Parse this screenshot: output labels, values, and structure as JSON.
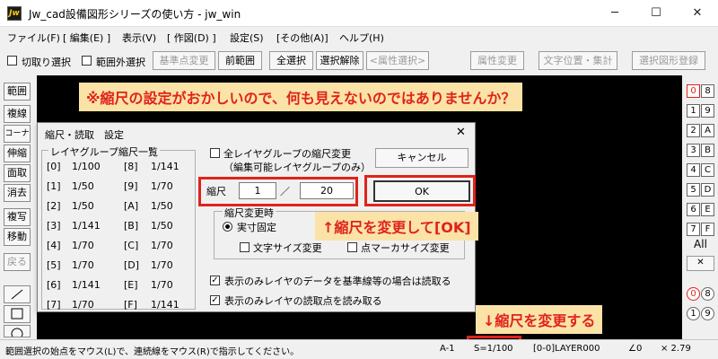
{
  "window": {
    "icon_text": "Jw",
    "title": "Jw_cad設備図形シリーズの使い方 - jw_win",
    "min": "─",
    "max": "☐",
    "close": "✕"
  },
  "menu": [
    "ファイル(F)",
    "[ 編集(E) ]",
    "表示(V)",
    "[ 作図(D) ]",
    "設定(S)",
    "[その他(A)]",
    "ヘルプ(H)"
  ],
  "toolbar": {
    "chk1": "切取り選択",
    "chk2": "範囲外選択",
    "base_point": "基準点変更",
    "prev_range": "前範囲",
    "select_all": "全選択",
    "deselect": "選択解除",
    "attr_select": "<属性選択>",
    "attr_change": "属性変更",
    "text_pos": "文字位置・集計",
    "register": "選択図形登録"
  },
  "left_tools": [
    "範囲",
    "複線",
    "コーナー",
    "伸縮",
    "面取",
    "消去",
    "複写",
    "移動",
    "戻る"
  ],
  "right_panel": {
    "row1": [
      [
        "0",
        "8"
      ],
      [
        "1",
        "9"
      ],
      [
        "2",
        "A"
      ],
      [
        "3",
        "B"
      ],
      [
        "4",
        "C"
      ],
      [
        "5",
        "D"
      ],
      [
        "6",
        "E"
      ],
      [
        "7",
        "F"
      ]
    ],
    "all": "All",
    "x": "✕",
    "row2": [
      [
        "0",
        "8"
      ],
      [
        "1",
        "9"
      ]
    ]
  },
  "dialog": {
    "title": "縮尺・読取　設定",
    "group_title": "レイヤグループ縮尺一覧",
    "layers_left": [
      [
        "[0]",
        "1/100"
      ],
      [
        "[1]",
        "1/50"
      ],
      [
        "[2]",
        "1/50"
      ],
      [
        "[3]",
        "1/141"
      ],
      [
        "[4]",
        "1/70"
      ],
      [
        "[5]",
        "1/70"
      ],
      [
        "[6]",
        "1/141"
      ],
      [
        "[7]",
        "1/70"
      ]
    ],
    "layers_right": [
      [
        "[8]",
        "1/141"
      ],
      [
        "[9]",
        "1/70"
      ],
      [
        "[A]",
        "1/50"
      ],
      [
        "[B]",
        "1/50"
      ],
      [
        "[C]",
        "1/70"
      ],
      [
        "[D]",
        "1/70"
      ],
      [
        "[E]",
        "1/70"
      ],
      [
        "[F]",
        "1/141"
      ]
    ],
    "all_change": "全レイヤグループの縮尺変更",
    "all_change_sub": "（編集可能レイヤグループのみ）",
    "cancel": "キャンセル",
    "ok": "OK",
    "scale_label": "縮尺",
    "scale_num": "1",
    "scale_sep": "／",
    "scale_den": "20",
    "change_group": "縮尺変更時",
    "fixed": "実寸固定",
    "text_size": "文字サイズ変更",
    "marker_size": "点マーカサイズ変更",
    "opt1": "表示のみレイヤのデータを基準線等の場合は読取る",
    "opt2": "表示のみレイヤの読取点を読み取る"
  },
  "annotations": {
    "top": "※縮尺の設定がおかしいので、何も見えないのではありませんか？",
    "ok": "↑縮尺を変更して[OK]",
    "bottom": "↓縮尺を変更する"
  },
  "status": {
    "msg": "範囲選択の始点をマウス(L)で、連続線をマウス(R)で指示してください。",
    "paper": "A-1",
    "scale": "S=1/100",
    "layer": "[0-0]LAYER000",
    "angle": "∠0",
    "ratio": "× 2.79"
  }
}
